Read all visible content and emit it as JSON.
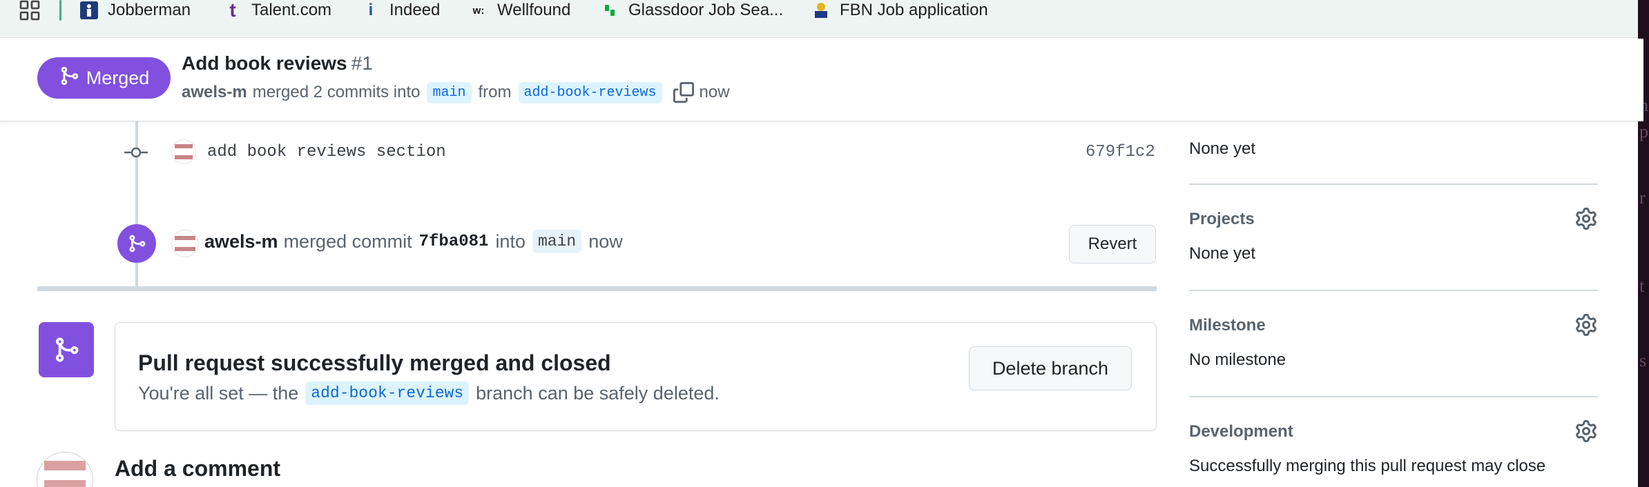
{
  "bookmarks": [
    {
      "label": "Jobberman",
      "icon": "jobberman-icon"
    },
    {
      "label": "Talent.com",
      "icon": "talent-icon"
    },
    {
      "label": "Indeed",
      "icon": "indeed-icon"
    },
    {
      "label": "Wellfound",
      "icon": "wellfound-icon"
    },
    {
      "label": "Glassdoor Job Sea...",
      "icon": "glassdoor-icon"
    },
    {
      "label": "FBN Job application",
      "icon": "fbn-icon"
    }
  ],
  "pr_header": {
    "status": "Merged",
    "title": "Add book reviews",
    "number": "#1",
    "author": "awels-m",
    "merged_text": "merged 2 commits into",
    "base_branch": "main",
    "from_text": "from",
    "head_branch": "add-book-reviews",
    "time": "now"
  },
  "timeline": {
    "commit": {
      "message": "add book reviews section",
      "sha": "679f1c2"
    },
    "merge_event": {
      "author": "awels-m",
      "action": "merged commit",
      "sha": "7fba081",
      "into": "into",
      "branch": "main",
      "time": "now",
      "revert_label": "Revert"
    }
  },
  "merged_box": {
    "title": "Pull request successfully merged and closed",
    "desc_before": "You're all set — the",
    "branch": "add-book-reviews",
    "desc_after": "branch can be safely deleted.",
    "delete_label": "Delete branch"
  },
  "comment": {
    "heading": "Add a comment"
  },
  "sidebar": {
    "top_value": "None yet",
    "projects": {
      "title": "Projects",
      "value": "None yet"
    },
    "milestone": {
      "title": "Milestone",
      "value": "No milestone"
    },
    "development": {
      "title": "Development",
      "value": "Successfully merging this pull request may close"
    }
  },
  "edge_letters": [
    "n",
    "p",
    "r",
    "t",
    "s"
  ],
  "colors": {
    "merged_purple": "#8250df",
    "link_blue": "#0969da",
    "branch_bg": "#ddf4ff"
  }
}
